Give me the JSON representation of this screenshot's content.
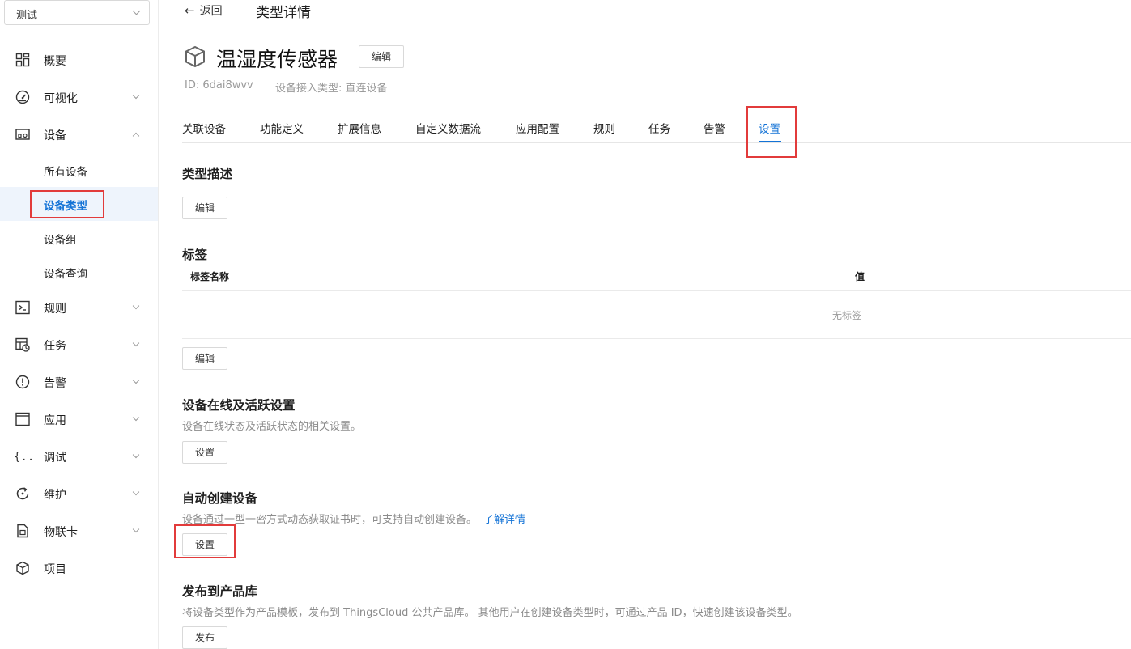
{
  "sidebar": {
    "project": "测试",
    "items": [
      {
        "label": "概要",
        "icon": "dashboard-icon"
      },
      {
        "label": "可视化",
        "icon": "gauge-icon"
      },
      {
        "label": "设备",
        "icon": "device-icon"
      },
      {
        "label": "规则",
        "icon": "terminal-icon"
      },
      {
        "label": "任务",
        "icon": "task-icon"
      },
      {
        "label": "告警",
        "icon": "alert-icon"
      },
      {
        "label": "应用",
        "icon": "window-icon"
      },
      {
        "label": "调试",
        "icon": "code-braces-icon"
      },
      {
        "label": "维护",
        "icon": "refresh-icon"
      },
      {
        "label": "物联卡",
        "icon": "sim-card-icon"
      },
      {
        "label": "项目",
        "icon": "cube-icon"
      }
    ],
    "device_sub": [
      "所有设备",
      "设备类型",
      "设备组",
      "设备查询"
    ],
    "active_sub": "设备类型"
  },
  "header": {
    "back": "返回",
    "page": "类型详情"
  },
  "device_type": {
    "name": "温湿度传感器",
    "edit": "编辑",
    "id": "ID: 6dai8wvv",
    "access": "设备接入类型: 直连设备"
  },
  "tabs": [
    "关联设备",
    "功能定义",
    "扩展信息",
    "自定义数据流",
    "应用配置",
    "规则",
    "任务",
    "告警",
    "设置"
  ],
  "active_tab": "设置",
  "sections": {
    "desc": {
      "title": "类型描述",
      "button": "编辑"
    },
    "tags": {
      "title": "标签",
      "col_name": "标签名称",
      "col_value": "值",
      "empty": "无标签",
      "button": "编辑"
    },
    "online": {
      "title": "设备在线及活跃设置",
      "text": "设备在线状态及活跃状态的相关设置。",
      "button": "设置"
    },
    "auto_create": {
      "title": "自动创建设备",
      "text": "设备通过一型一密方式动态获取证书时，可支持自动创建设备。",
      "link": "了解详情",
      "button": "设置"
    },
    "publish": {
      "title": "发布到产品库",
      "text": "将设备类型作为产品模板，发布到 ThingsCloud 公共产品库。 其他用户在创建设备类型时，可通过产品 ID，快速创建该设备类型。",
      "button": "发布"
    }
  },
  "colors": {
    "accent": "#1473d6",
    "highlight": "#e23b3b"
  }
}
